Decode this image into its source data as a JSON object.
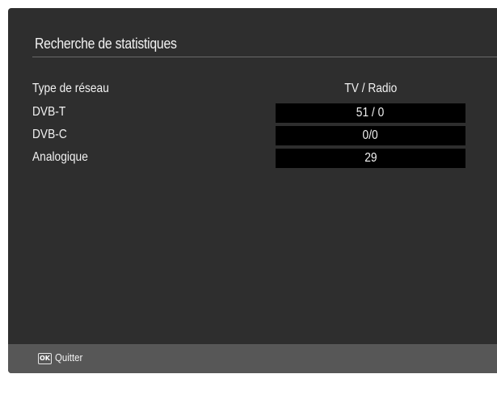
{
  "dialog": {
    "title": "Recherche de statistiques"
  },
  "table": {
    "header": {
      "label": "Type de réseau",
      "value": "TV / Radio"
    },
    "rows": [
      {
        "label": "DVB-T",
        "value": "51 / 0"
      },
      {
        "label": "DVB-C",
        "value": "0/0"
      },
      {
        "label": "Analogique",
        "value": "29"
      }
    ]
  },
  "footer": {
    "ok_key": "OK",
    "quit_label": "Quitter"
  }
}
